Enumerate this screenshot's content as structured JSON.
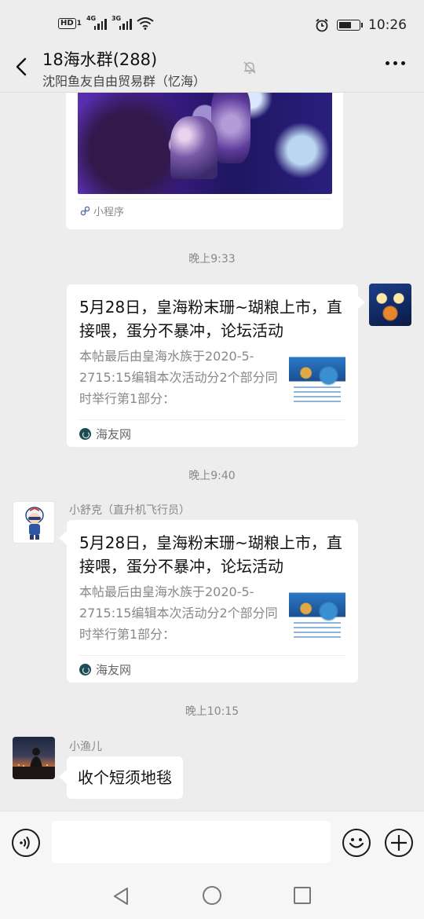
{
  "status_bar": {
    "hd": "HD",
    "sim1": "1",
    "net1": "4G",
    "net2": "3G",
    "time": "10:26",
    "battery_level": 0.55
  },
  "header": {
    "title": "18海水群(288)",
    "subtitle": "沈阳鱼友自由贸易群（忆海）"
  },
  "mini_program": {
    "label": "小程序"
  },
  "timestamps": [
    "晚上9:33",
    "晚上9:40",
    "晚上10:15"
  ],
  "messages": [
    {
      "title": "5月28日，皇海粉末珊~瑚粮上市，直接喂，蛋分不暴冲，论坛活动",
      "desc": "本帖最后由皇海水族于2020-5-2715:15编辑本次活动分2个部分同时举行第1部分：",
      "source": "海友网"
    },
    {
      "sender": "小舒克（直升机飞行员）",
      "title": "5月28日，皇海粉末珊~瑚粮上市，直接喂，蛋分不暴冲，论坛活动",
      "desc": "本帖最后由皇海水族于2020-5-2715:15编辑本次活动分2个部分同时举行第1部分：",
      "source": "海友网"
    },
    {
      "sender": "小渔儿",
      "text": "收个短须地毯"
    }
  ],
  "colors": {
    "background": "#ededed",
    "bubble": "#ffffff",
    "secondary_text": "#888888"
  }
}
